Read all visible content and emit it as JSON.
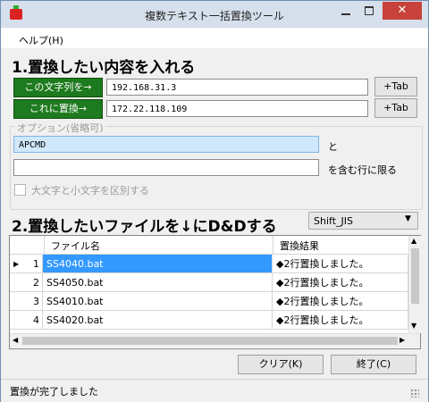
{
  "window": {
    "title": "複数テキスト一括置換ツール",
    "close_glyph": "✕"
  },
  "menu": {
    "help": "ヘルプ(H)"
  },
  "section1": {
    "title": "1.置換したい内容を入れる",
    "find_button": "この文字列を→",
    "find_value": "192.168.31.3",
    "replace_button": "これに置換→",
    "replace_value": "172.22.118.109",
    "tab_button": "+Tab"
  },
  "options": {
    "group_label": "オプション(省略可)",
    "text1_value": "APCMD",
    "text1_suffix": "と",
    "text2_value": "",
    "text2_suffix": "を含む行に限る",
    "case_checkbox_label": "大文字と小文字を区別する",
    "case_checked": false
  },
  "section2": {
    "title": "2.置換したいファイルを↓にD&Dする",
    "encoding": "Shift_JIS"
  },
  "grid": {
    "columns": [
      "ファイル名",
      "置換結果"
    ],
    "rows": [
      {
        "index": "1",
        "file": "SS4040.bat",
        "result": "◆2行置換しました。",
        "current": true
      },
      {
        "index": "2",
        "file": "SS4050.bat",
        "result": "◆2行置換しました。",
        "current": false
      },
      {
        "index": "3",
        "file": "SS4010.bat",
        "result": "◆2行置換しました。",
        "current": false
      },
      {
        "index": "4",
        "file": "SS4020.bat",
        "result": "◆2行置換しました。",
        "current": false
      }
    ]
  },
  "buttons": {
    "clear": "クリア(K)",
    "exit": "終了(C)"
  },
  "status": {
    "text": "置換が完了しました"
  },
  "colors": {
    "accent_green": "#1e7a1e",
    "selection_blue": "#3399ff",
    "close_red": "#c7423a"
  }
}
